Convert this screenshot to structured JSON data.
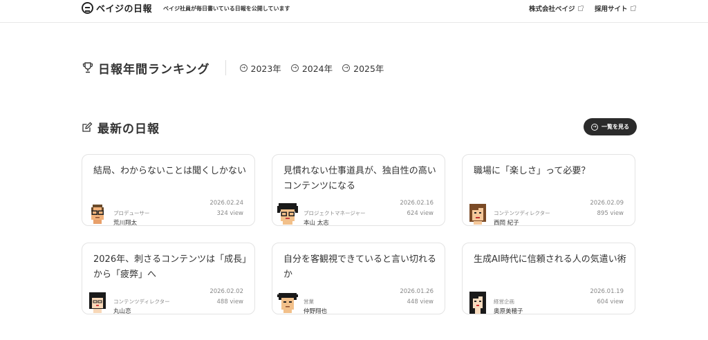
{
  "header": {
    "logo_text": "ベイジの日報",
    "tagline": "ベイジ社員が毎日書いている日報を公開しています",
    "nav": [
      {
        "label": "株式会社ベイジ"
      },
      {
        "label": "採用サイト"
      }
    ]
  },
  "ranking": {
    "title": "日報年間ランキング",
    "years": [
      "2023年",
      "2024年",
      "2025年"
    ]
  },
  "latest": {
    "title": "最新の日報",
    "list_button": "一覧を見る"
  },
  "cards": [
    {
      "title": "結局、わからないことは聞くしかない",
      "date": "2026.02.24",
      "views": "324 view",
      "role": "プロデューサー",
      "author": "荒川翔太",
      "avatar": "glasses-man"
    },
    {
      "title": "見慣れない仕事道具が、独自性の高いコンテンツになる",
      "date": "2026.02.16",
      "views": "624 view",
      "role": "プロジェクトマネージャー",
      "author": "本山 太志",
      "avatar": "curly-glasses-man"
    },
    {
      "title": "職場に「楽しさ」って必要？",
      "date": "2026.02.09",
      "views": "895 view",
      "role": "コンテンツディレクター",
      "author": "西岡 紀子",
      "avatar": "brown-hair-woman"
    },
    {
      "title": "2026年、刺さるコンテンツは「成長」から「疲弊」へ",
      "date": "2026.02.02",
      "views": "488 view",
      "role": "コンテンツディレクター",
      "author": "丸山恋",
      "avatar": "bob-hair-woman"
    },
    {
      "title": "自分を客観視できていると言い切れるか",
      "date": "2026.01.26",
      "views": "448 view",
      "role": "営業",
      "author": "仲野翔也",
      "avatar": "spiky-hair-man"
    },
    {
      "title": "生成AI時代に信頼される人の気遣い術",
      "date": "2026.01.19",
      "views": "604 view",
      "role": "経営企画",
      "author": "奥原美穂子",
      "avatar": "long-hair-woman"
    }
  ]
}
